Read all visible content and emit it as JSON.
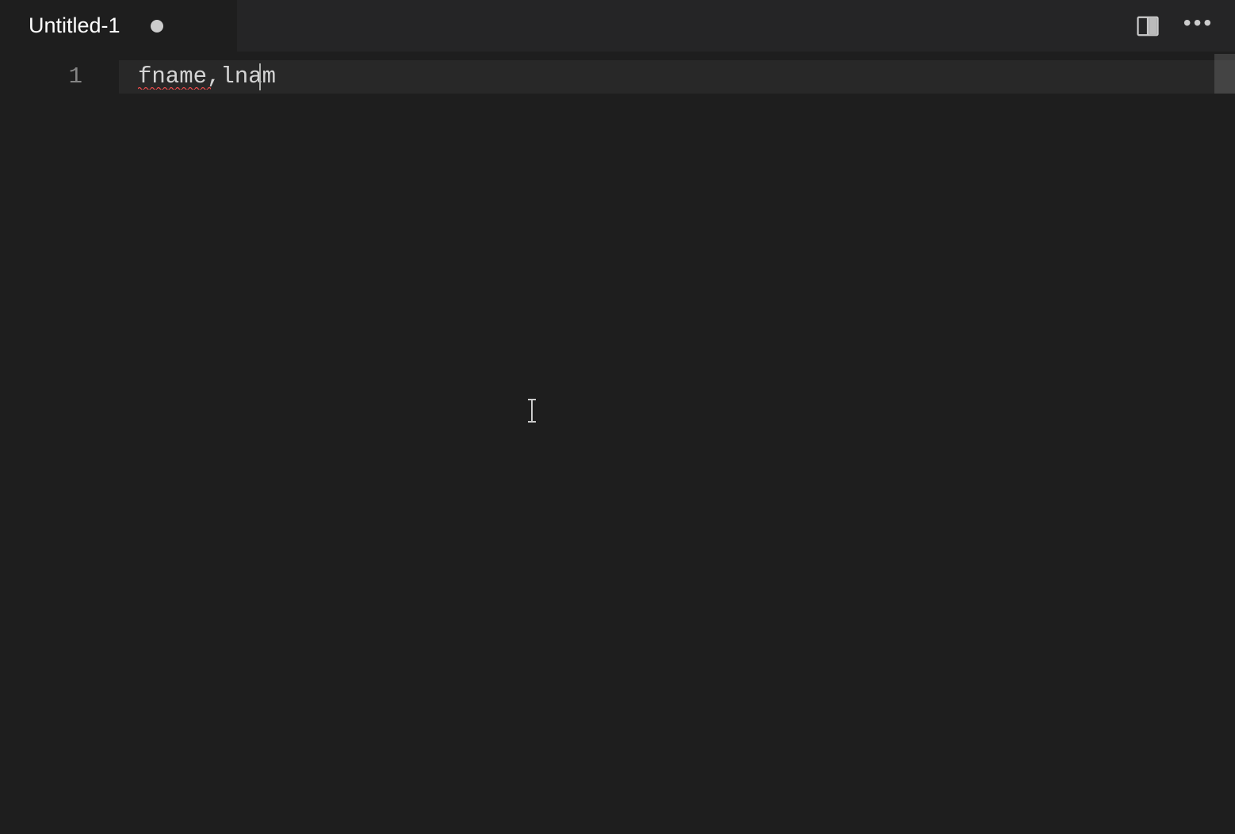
{
  "tab": {
    "label": "Untitled-1",
    "dirty": true
  },
  "editor": {
    "lines": [
      {
        "number": "1",
        "content": "fname,lnam"
      }
    ],
    "error_underline_word": "fname"
  },
  "icons": {
    "split": "split-editor-icon",
    "more": "more-actions-icon"
  }
}
